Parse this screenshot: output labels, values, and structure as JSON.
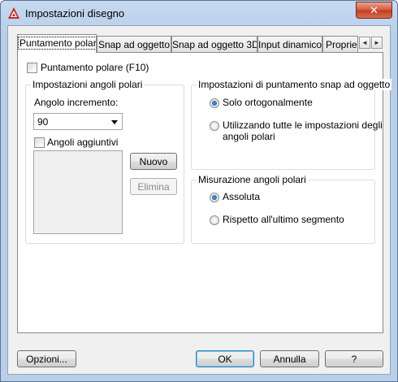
{
  "window": {
    "title": "Impostazioni disegno",
    "close_glyph": "✕"
  },
  "tabs": [
    {
      "label": "Puntamento polare"
    },
    {
      "label": "Snap ad oggetto"
    },
    {
      "label": "Snap ad oggetto 3D"
    },
    {
      "label": "Input dinamico"
    },
    {
      "label": "Proprietà"
    }
  ],
  "tab_scroll": {
    "left": "◄",
    "right": "►"
  },
  "polar": {
    "enable_label": "Puntamento polare (F10)",
    "enable_checked": false,
    "angles_group_title": "Impostazioni angoli polari",
    "increment_label": "Angolo incremento:",
    "increment_value": "90",
    "additional_label": "Angoli aggiuntivi",
    "additional_checked": false,
    "new_button": "Nuovo",
    "delete_button": "Elimina"
  },
  "snap_tracking": {
    "group_title": "Impostazioni di puntamento snap ad oggetto",
    "option_ortho": "Solo ortogonalmente",
    "option_all_line1": "Utilizzando tutte le impostazioni degli",
    "option_all_line2": "angoli polari",
    "selected": "ortho"
  },
  "polar_measure": {
    "group_title": "Misurazione angoli polari",
    "option_absolute": "Assoluta",
    "option_relative": "Rispetto all'ultimo segmento",
    "selected": "absolute"
  },
  "footer": {
    "options_button": "Opzioni...",
    "ok_button": "OK",
    "cancel_button": "Annulla",
    "help_button": "?"
  }
}
